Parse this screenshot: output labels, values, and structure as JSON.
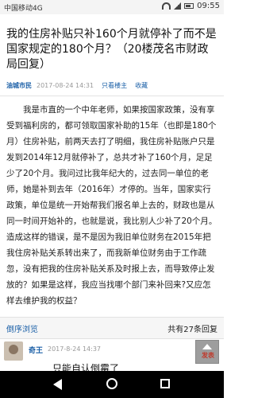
{
  "status_bar": {
    "carrier": "中国移动4G",
    "time": "09:55"
  },
  "thread": {
    "title": "我的住房补贴只补160个月就停补了而不是国家规定的180个月？（20楼茂名市财政局回复）",
    "author": "油城市民",
    "timestamp": "2017-08-24 14:31",
    "only_author_label": "只看楼主",
    "favorite_label": "收藏",
    "body": "我是市直的一个中年老师，如果按国家政策，没有享受到福利房的，都可领取国家补助的15年（也即是180个月）住房补贴，前两天去打了明细，我住房补贴账户只是发到2014年12月就停补了，总共才补了160个月，足足少了20个月。我问过比我年纪大的，过去同一单位的老师，她是补到去年（2016年）才停的。当年，国家实行政策，单位是统一开始帮我们报名单上去的，财政也是从同一时间开始补的，也就是说，我比别人少补了20个月。造成这样的错误，是不是因为我旧单位财务在2015年把我住房补贴关系转出来了，而我新单位财务由于工作疏忽，没有把我的住房补贴关系及时报上去，而导致停止发放的？如果是这样，我应当找哪个部门来补回来?又应怎样去维护我的权益？"
  },
  "footer": {
    "left_label": "倒序浏览",
    "reply_count": "共有27条回复"
  },
  "reply": {
    "author": "奇王",
    "timestamp": "2017-8-24 14:37",
    "text": "只能自认倒霉了"
  },
  "floating_button": {
    "icon": "arrow-up-icon",
    "label": "发表"
  },
  "colors": {
    "link_blue": "#1a5fa7",
    "meta_gray": "#999999",
    "nav_bg": "#000000"
  }
}
